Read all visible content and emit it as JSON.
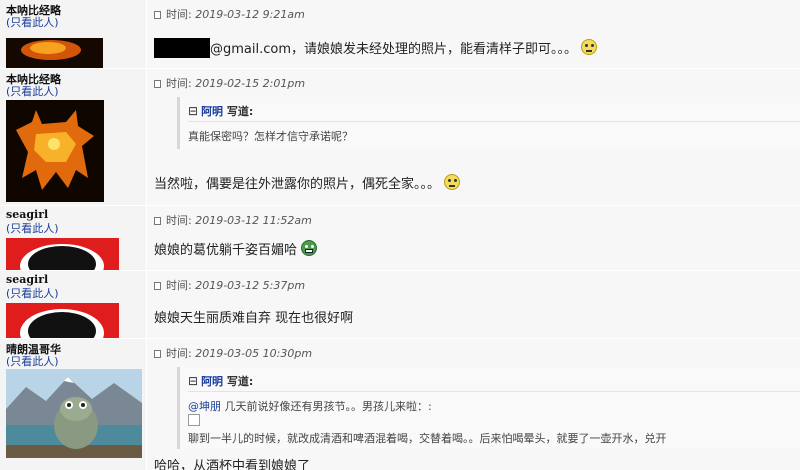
{
  "posts": [
    {
      "user": "本呐比经略",
      "only_link": "(只看此人)",
      "avatar_icon": "fire-bull-icon",
      "time_label": "时间:",
      "time": "2019-03-12 9:21am",
      "message_after_redact": "@gmail.com，请娘娘发未经处理的照片，能看清样子即可。。。",
      "emoji": "rolling-eyes-emoji"
    },
    {
      "user": "本呐比经略",
      "only_link": "(只看此人)",
      "avatar_icon": "fire-bull-icon",
      "time_label": "时间:",
      "time": "2019-02-15 2:01pm",
      "quote": {
        "author": "阿明",
        "wrote": "写道:",
        "text": "真能保密吗？怎样才信守承诺呢？"
      },
      "message": "当然啦，偶要是往外泄露你的照片，偶死全家。。。",
      "emoji": "rolling-eyes-emoji"
    },
    {
      "user": "seagirl",
      "only_link": "(只看此人)",
      "avatar_icon": "silhouette-avatar-icon",
      "time_label": "时间:",
      "time": "2019-03-12 11:52am",
      "message": "娘娘的葛优躺千姿百媚哈",
      "emoji": "grin-emoji"
    },
    {
      "user": "seagirl",
      "only_link": "(只看此人)",
      "avatar_icon": "silhouette-avatar-icon",
      "time_label": "时间:",
      "time": "2019-03-12 5:37pm",
      "message": "娘娘天生丽质难自弃 现在也很好啊"
    },
    {
      "user": "晴朗温哥华",
      "only_link": "(只看此人)",
      "avatar_icon": "frog-lake-photo-icon",
      "time_label": "时间:",
      "time": "2019-03-05 10:30pm",
      "quote": {
        "author": "阿明",
        "wrote": "写道:",
        "mention": "@坤朋",
        "line1": " 几天前说好像还有男孩节。。男孩儿来啦：:",
        "line2": "聊到一半儿的时候，就改成清酒和啤酒混着喝，交替着喝。。后来怕喝晕头，就要了一壶开水，兑",
        "line2_tail": "开"
      },
      "message": "哈哈，从酒杯中看到娘娘了"
    }
  ],
  "colors": {
    "left_bg": "#f4f4f4",
    "right_bg": "#f7f7f7",
    "link": "#1a3d9a"
  }
}
